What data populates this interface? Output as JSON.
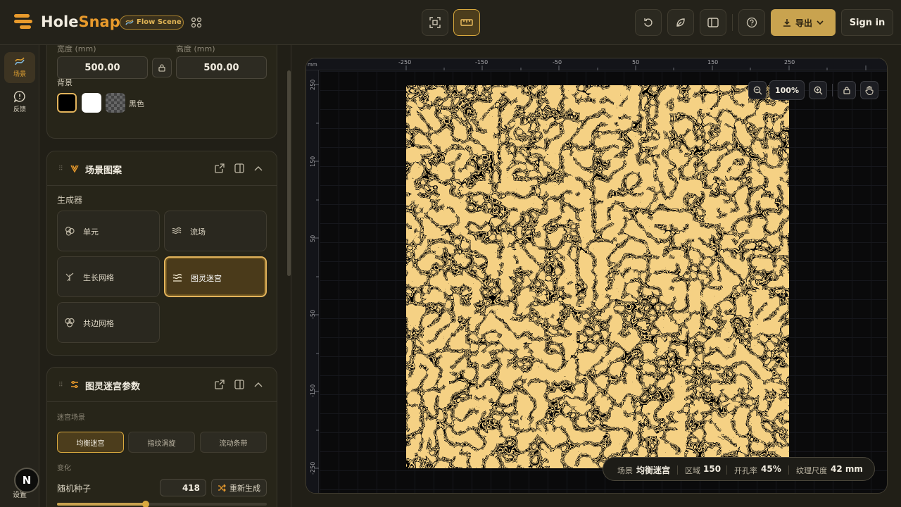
{
  "app": {
    "brand_part1": "Hole",
    "brand_part2": "Snap",
    "tag": "Flow Scene",
    "accent": "#e89a2c"
  },
  "toolbar": {
    "export_label": "导出",
    "signin_label": "Sign in"
  },
  "rail": {
    "items": [
      {
        "label": "场景",
        "icon": "scene-icon",
        "active": true
      },
      {
        "label": "反馈",
        "icon": "feedback-icon",
        "active": false
      }
    ],
    "bottom_label": "设置",
    "avatar_letter": "N"
  },
  "dimensions": {
    "width_label": "宽度 (mm)",
    "width_value": "500.00",
    "height_label": "高度 (mm)",
    "height_value": "500.00",
    "background_label": "背景",
    "background_selected": "黑色",
    "swatches": [
      "#000000",
      "#ffffff",
      "checker"
    ]
  },
  "scene_pattern": {
    "title": "场景图案",
    "generator_label": "生成器",
    "generators": [
      {
        "label": "单元",
        "icon": "cells-icon"
      },
      {
        "label": "流场",
        "icon": "flow-icon"
      },
      {
        "label": "生长网络",
        "icon": "growth-icon"
      },
      {
        "label": "图灵迷宫",
        "icon": "turing-icon",
        "selected": true
      },
      {
        "label": "共边网格",
        "icon": "shared-edge-icon"
      }
    ]
  },
  "turing_params": {
    "title": "图灵迷宫参数",
    "scene_label": "迷宫场景",
    "scenes": [
      "均衡迷宫",
      "指纹涡旋",
      "流动条带"
    ],
    "selected_scene": "均衡迷宫",
    "variation_label": "变化",
    "seed_label": "随机种子",
    "seed_value": "418",
    "regenerate_label": "重新生成"
  },
  "viewport": {
    "ruler_unit": "mm",
    "x_ticks": [
      "-250",
      "-150",
      "-50",
      "50",
      "150",
      "250"
    ],
    "y_ticks": [
      "250",
      "150",
      "50",
      "-50",
      "-150",
      "-250"
    ],
    "zoom": "100%",
    "pattern_color": "#e8a33a"
  },
  "status": {
    "scene_key": "场景",
    "scene_value": "均衡迷宫",
    "region_key": "区域",
    "region_value": "150",
    "open_key": "开孔率",
    "open_value": "45%",
    "texture_key": "纹理尺度",
    "texture_value": "42 mm"
  }
}
